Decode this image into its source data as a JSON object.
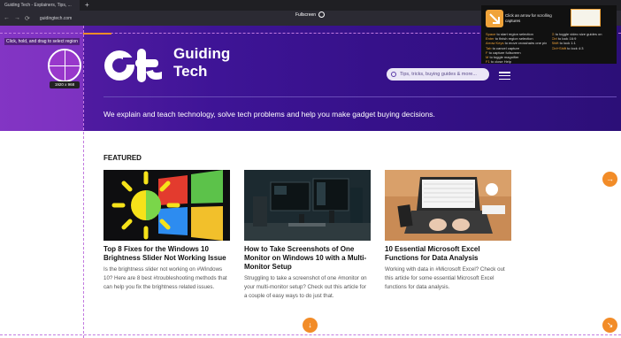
{
  "browser": {
    "tab_title": "Guiding Tech - Explainers, Tips, ...",
    "new_tab": "+",
    "url": "guidingtech.com",
    "fullscreen_label": "Fullscreen",
    "back": "←",
    "forward": "→",
    "reload": "⟳"
  },
  "capture": {
    "hint": "Click, hold, and drag to select region",
    "coords": "1920 x 968",
    "help_title": "Click an arrow for scrolling captures",
    "help_rows": [
      {
        "key": "Space",
        "text": "to start region selection"
      },
      {
        "key": "G",
        "text": "to toggle video size guides on"
      },
      {
        "key": "Enter",
        "text": "to finish region selection"
      },
      {
        "key": "Ctrl",
        "text": "to lock 16:9"
      },
      {
        "key": "Arrow Keys",
        "text": "to move crosshairs one pixel"
      },
      {
        "key": "Shift",
        "text": "to lock 1:1"
      },
      {
        "key": "Tab",
        "text": "to cancel capture"
      },
      {
        "key": "Ctrl+Shift",
        "text": "to lock 4:3"
      },
      {
        "key": "F",
        "text": "to capture fullscreen"
      },
      {
        "key": "",
        "text": ""
      },
      {
        "key": "M",
        "text": "to toggle magnifier"
      },
      {
        "key": "",
        "text": ""
      },
      {
        "key": "F1",
        "text": "to close Help"
      },
      {
        "key": "",
        "text": ""
      }
    ]
  },
  "site": {
    "brand_line1": "Guiding",
    "brand_line2": "Tech",
    "search_placeholder": "Tips, tricks, buying guides & more...",
    "tagline": "We explain and teach technology, solve tech problems and help you make gadget buying decisions.",
    "featured_label": "FEATURED",
    "cards": [
      {
        "title": "Top 8 Fixes for the Windows 10 Brightness Slider Not Working Issue",
        "desc": "Is the brightness slider not working on #Windows 10? Here are 8 best #troubleshooting methods that can help you fix the brightness related issues."
      },
      {
        "title": "How to Take Screenshots of One Monitor on Windows 10 with a Multi-Monitor Setup",
        "desc": "Struggling to take a screenshot of one #monitor on your multi-monitor setup? Check out this article for a couple of easy ways to do just that."
      },
      {
        "title": "10 Essential Microsoft Excel Functions for Data Analysis",
        "desc": "Working with data in #Microsoft Excel? Check out this article for some essential Microsoft Excel functions for data analysis."
      }
    ],
    "scroll_right": "→",
    "scroll_down": "↓",
    "scroll_diag": "↘"
  },
  "colors": {
    "accent": "#f28c28",
    "hero": "#3e1496"
  }
}
